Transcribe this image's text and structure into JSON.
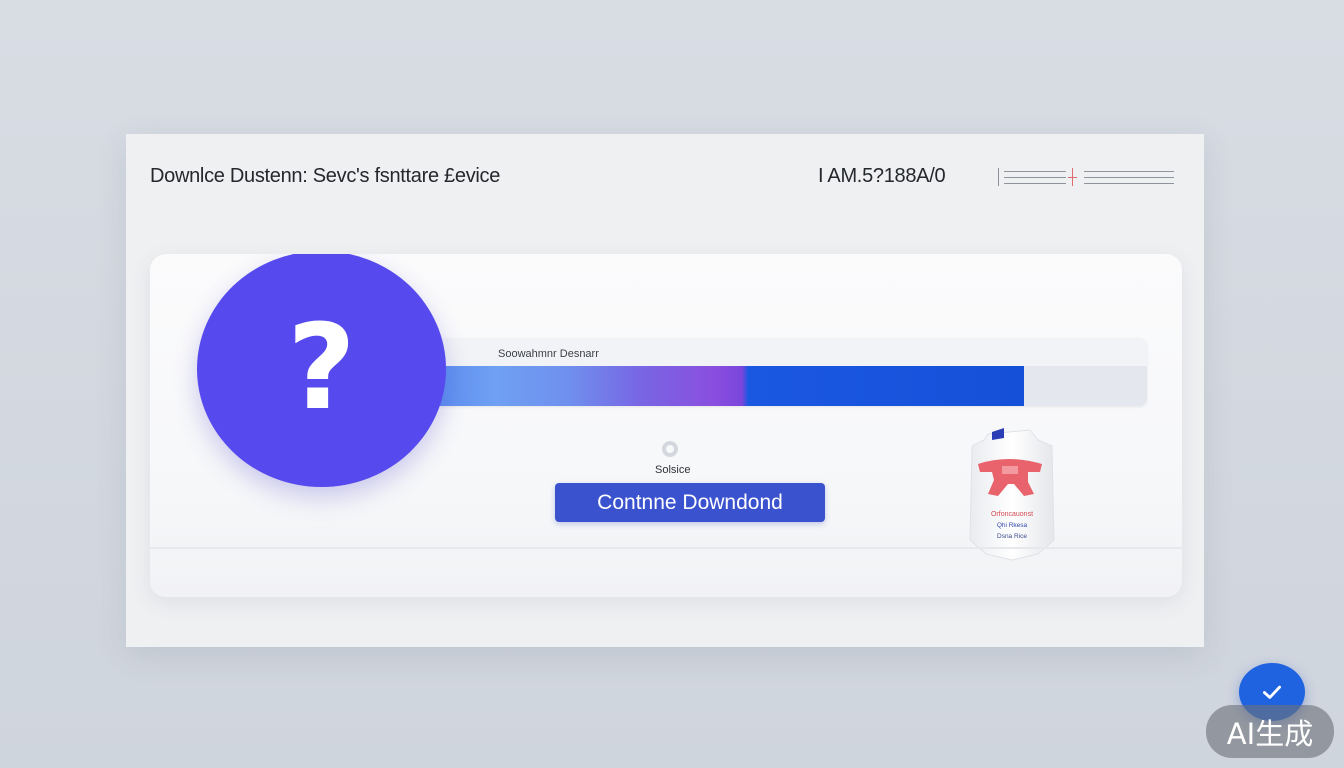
{
  "window": {
    "title": "Downlce Dustenn: Sevc's fsnttare £evice",
    "time": "I AM.5?188A/0"
  },
  "download": {
    "progress_label": "Soowahmnr Desnarr",
    "progress": 0.83,
    "status_label": "Solsice",
    "continue_label": "Contnne Downdond",
    "question_glyph": "?"
  },
  "package": {
    "lines": [
      "Orfoncauonst",
      "Qhi Rkesa",
      "Dsna Rice"
    ]
  },
  "icons": {
    "main": "question-mark-icon",
    "confirm": "checkmark-icon",
    "package": "package-bottle-icon"
  },
  "colors": {
    "accent": "#5649ed",
    "button": "#3b52cf",
    "confirm": "#1f63e0",
    "progress_end": "#1550d8"
  },
  "watermark": "AI生成"
}
